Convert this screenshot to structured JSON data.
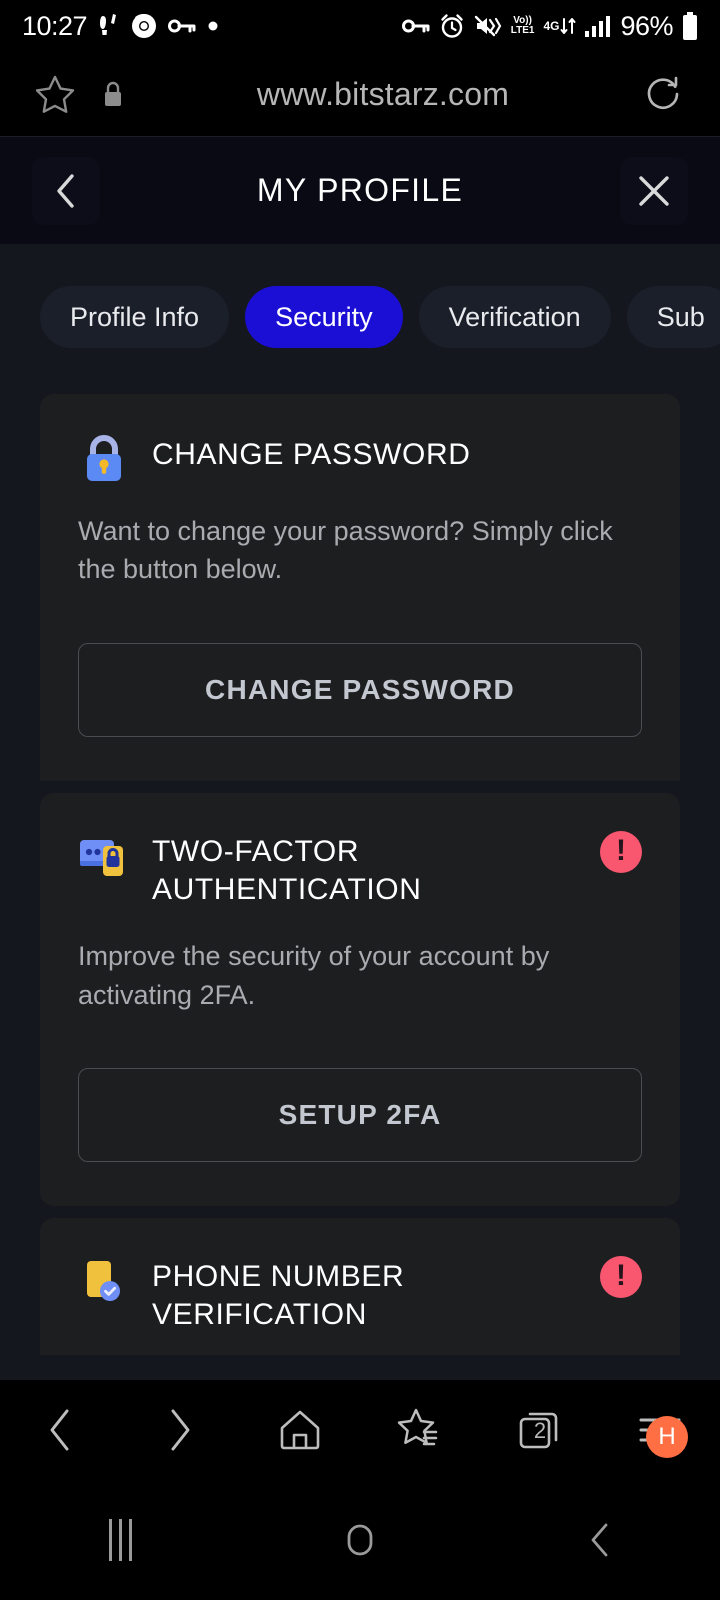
{
  "status_bar": {
    "time": "10:27",
    "battery_percent": "96%",
    "network_volte": "Vo))",
    "network_lte": "LTE1",
    "network_4g": "4G",
    "left_icons": [
      "footsteps-icon",
      "chrome-icon",
      "key-icon",
      "dot-icon"
    ],
    "right_icons": [
      "key-icon",
      "alarm-icon",
      "vibrate-icon",
      "volte-icon",
      "data-transfer-icon",
      "signal-bars-icon",
      "battery-icon"
    ]
  },
  "browser": {
    "url": "www.bitstarz.com",
    "star_icon": "star-icon",
    "lock_icon": "lock-icon",
    "reload_icon": "reload-icon",
    "toolbar": {
      "back": "back-arrow-icon",
      "forward": "forward-arrow-icon",
      "home": "home-icon",
      "bookmarks": "bookmarks-star-icon",
      "tabs": "tabs-icon",
      "tab_count": "2",
      "menu": "menu-icon",
      "menu_badge": "H"
    }
  },
  "page_header": {
    "title": "MY PROFILE",
    "back_label": "back-chevron-icon",
    "close_label": "close-x-icon"
  },
  "tabs": [
    {
      "label": "Profile Info",
      "active": false
    },
    {
      "label": "Security",
      "active": true
    },
    {
      "label": "Verification",
      "active": false
    },
    {
      "label": "Sub",
      "active": false
    }
  ],
  "sections": [
    {
      "id": "change-password",
      "icon": "padlock-icon",
      "title": "CHANGE PASSWORD",
      "description": "Want to change your password? Simply click the button below.",
      "button": "CHANGE PASSWORD",
      "alert": false
    },
    {
      "id": "two-factor-authentication",
      "icon": "two-factor-icon",
      "title": "TWO-FACTOR AUTHENTICATION",
      "description": "Improve the security of your account by activating 2FA.",
      "button": "SETUP 2FA",
      "alert": true,
      "alert_mark": "!"
    },
    {
      "id": "phone-number-verification",
      "icon": "phone-verified-icon",
      "title": "PHONE NUMBER VERIFICATION",
      "alert": true,
      "alert_mark": "!"
    }
  ],
  "android_nav": {
    "recents": "recents-icon",
    "home": "home-circle-icon",
    "back": "back-chevron-icon"
  },
  "colors": {
    "accent_blue": "#1b0fd6",
    "alert_pink": "#f9566f",
    "page_bg": "#15171e",
    "card_bg": "#1d1e20",
    "menu_badge_orange": "#ff6f43"
  }
}
